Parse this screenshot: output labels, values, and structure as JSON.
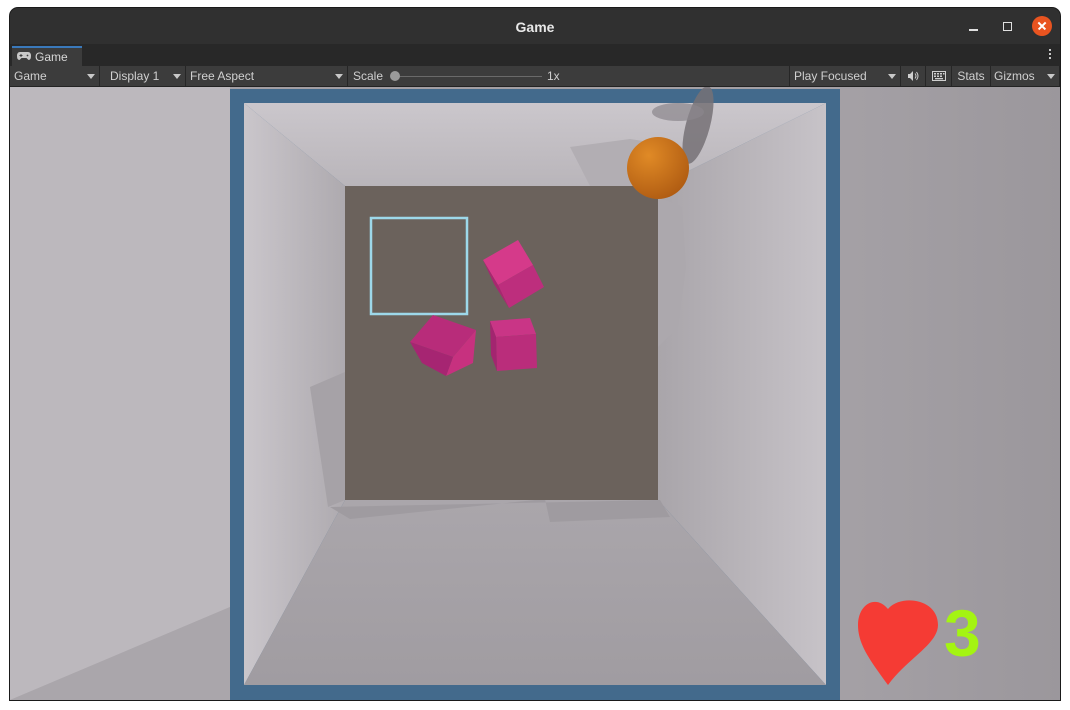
{
  "window": {
    "title": "Game"
  },
  "tab": {
    "label": "Game"
  },
  "toolbar": {
    "view_mode": "Game",
    "display": "Display 1",
    "aspect": "Free Aspect",
    "scale_label": "Scale",
    "scale_value": "1x",
    "play_mode": "Play Focused",
    "stats": "Stats",
    "gizmos": "Gizmos"
  },
  "hud": {
    "lives": "3"
  },
  "colors": {
    "frame": "#436a8c",
    "floor": "#6b625c",
    "cube": "#c22f7e",
    "ball": "#d27a18",
    "heart": "#f53b34",
    "lives_text": "#a4f412",
    "selection": "#9dd8ea"
  }
}
